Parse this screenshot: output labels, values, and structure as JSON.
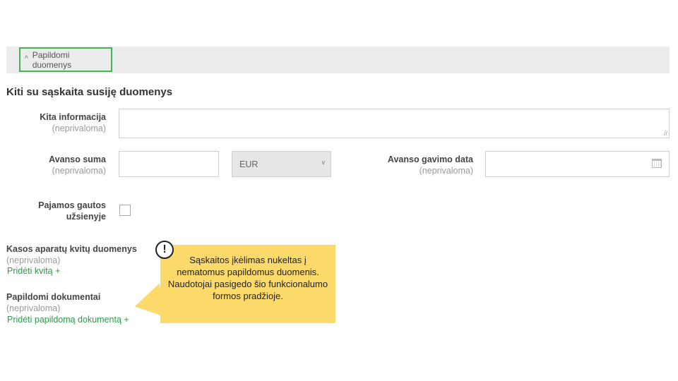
{
  "panel": {
    "toggle_label": "Papildomi duomenys",
    "toggle_icon": "chevron-up-icon"
  },
  "section": {
    "title": "Kiti su sąskaita susiję duomenys"
  },
  "fields": {
    "other_info": {
      "label": "Kita informacija",
      "hint": "(neprivaloma)",
      "value": ""
    },
    "advance_sum": {
      "label": "Avanso suma",
      "hint": "(neprivaloma)",
      "value": ""
    },
    "currency": {
      "selected": "EUR"
    },
    "advance_date": {
      "label": "Avanso gavimo data",
      "hint": "(neprivaloma)",
      "value": ""
    },
    "income_abroad": {
      "label_line1": "Pajamos gautos",
      "label_line2": "užsienyje",
      "checked": false
    }
  },
  "receipts": {
    "label": "Kasos aparatų kvitų duomenys",
    "hint": "(neprivaloma)",
    "add_link": "Pridėti kvitą  +"
  },
  "documents": {
    "label": "Papildomi dokumentai",
    "hint": "(neprivaloma)",
    "add_link": "Pridėti papildomą dokumentą  +"
  },
  "callout": {
    "icon": "warning-icon",
    "symbol": "!",
    "text": "Sąskaitos įkėlimas nukeltas į nematomus papildomus duomenis. Naudotojai pasigedo šio funkcionalumo formos pradžioje.",
    "color": "#fbd96b"
  },
  "colors": {
    "accent": "#45b35a",
    "link": "#2e9a48"
  }
}
